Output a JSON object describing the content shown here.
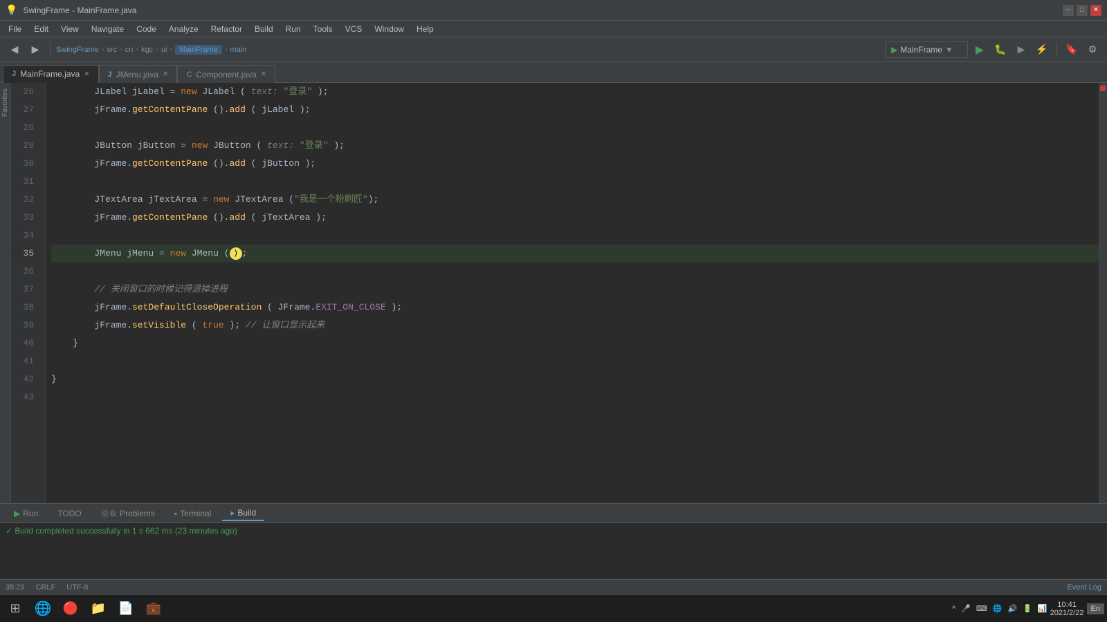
{
  "titleBar": {
    "title": "SwingFrame - MainFrame.java",
    "controls": [
      "minimize",
      "maximize",
      "close"
    ]
  },
  "menuBar": {
    "items": [
      "File",
      "Edit",
      "View",
      "Navigate",
      "Code",
      "Analyze",
      "Refactor",
      "Build",
      "Run",
      "Tools",
      "VCS",
      "Window",
      "Help"
    ]
  },
  "navBar": {
    "parts": [
      "SwingFrame",
      "src",
      "cn",
      "kgc",
      "ui",
      "MainFrame",
      "main"
    ]
  },
  "tabs": [
    {
      "label": "MainFrame.java",
      "type": "java",
      "active": true,
      "modified": false
    },
    {
      "label": "JMenu.java",
      "type": "java",
      "active": false,
      "modified": true
    },
    {
      "label": "Component.java",
      "type": "c",
      "active": false,
      "modified": true
    }
  ],
  "runConfig": {
    "label": "MainFrame"
  },
  "code": {
    "lines": [
      {
        "num": 26,
        "content": "        JLabel jLabel = new JLabel ( text: \"登录\" );"
      },
      {
        "num": 27,
        "content": "        jFrame.getContentPane ().add ( jLabel );"
      },
      {
        "num": 28,
        "content": ""
      },
      {
        "num": 29,
        "content": "        JButton jButton = new JButton ( text: \"登录\" );"
      },
      {
        "num": 30,
        "content": "        jFrame.getContentPane ().add ( jButton );"
      },
      {
        "num": 31,
        "content": ""
      },
      {
        "num": 32,
        "content": "        JTextArea jTextArea = new JTextArea (\"我是一个粉刷匠\");"
      },
      {
        "num": 33,
        "content": "        jFrame.getContentPane ().add ( jTextArea );"
      },
      {
        "num": 34,
        "content": ""
      },
      {
        "num": 35,
        "content": "        JMenu jMenu = new JMenu ();"
      },
      {
        "num": 36,
        "content": ""
      },
      {
        "num": 37,
        "content": "        // 关闭窗口的时候记得退掉进程"
      },
      {
        "num": 38,
        "content": "        jFrame.setDefaultCloseOperation ( JFrame.EXIT_ON_CLOSE );"
      },
      {
        "num": 39,
        "content": "        jFrame.setVisible ( true ); // 让窗口显示起来"
      },
      {
        "num": 40,
        "content": "    }"
      },
      {
        "num": 41,
        "content": ""
      },
      {
        "num": 42,
        "content": "}"
      },
      {
        "num": 43,
        "content": ""
      }
    ],
    "currentLine": 35
  },
  "bottomPanel": {
    "tabs": [
      "Run",
      "TODO",
      "Problems",
      "Terminal",
      "Build"
    ],
    "activeTab": "Build",
    "problemsCount": 6,
    "content": "Build completed successfully in 1 s 662 ms (23 minutes ago)"
  },
  "statusBar": {
    "position": "35:29",
    "lineEnding": "CRLF",
    "encoding": "UTF-8",
    "language": "En"
  },
  "taskbar": {
    "systemIcons": [
      "🔊",
      "🌐",
      "🔋"
    ],
    "time": "10:41",
    "date": "2021/2/22",
    "apps": [
      "⊞",
      "🌐",
      "🔵",
      "📁",
      "📄",
      "💼"
    ]
  }
}
